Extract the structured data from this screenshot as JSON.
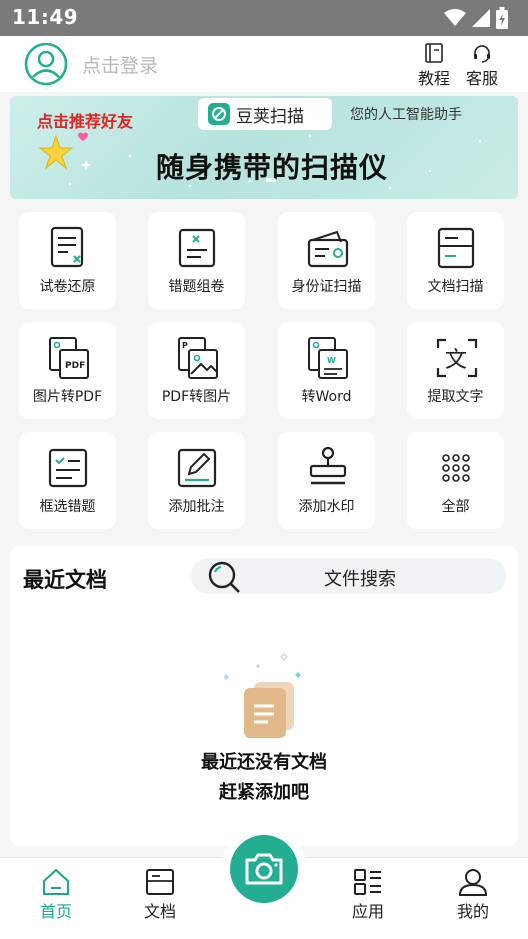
{
  "status_bar": {
    "time": "11:49"
  },
  "header": {
    "login_text": "点击登录",
    "tutorial": "教程",
    "service": "客服"
  },
  "banner": {
    "recommend": "点击推荐好友",
    "app_name": "豆荚扫描",
    "assistant": "您的人工智能助手",
    "slogan": "随身携带的扫描仪"
  },
  "tools": [
    {
      "label": "试卷还原",
      "icon": "paper-restore-icon"
    },
    {
      "label": "错题组卷",
      "icon": "wrong-question-icon"
    },
    {
      "label": "身份证扫描",
      "icon": "id-card-icon"
    },
    {
      "label": "文档扫描",
      "icon": "document-scan-icon"
    },
    {
      "label": "图片转PDF",
      "icon": "image-to-pdf-icon"
    },
    {
      "label": "PDF转图片",
      "icon": "pdf-to-image-icon"
    },
    {
      "label": "转Word",
      "icon": "to-word-icon"
    },
    {
      "label": "提取文字",
      "icon": "extract-text-icon"
    },
    {
      "label": "框选错题",
      "icon": "select-wrong-icon"
    },
    {
      "label": "添加批注",
      "icon": "annotate-icon"
    },
    {
      "label": "添加水印",
      "icon": "watermark-stamp-icon"
    },
    {
      "label": "全部",
      "icon": "all-apps-icon"
    }
  ],
  "recent": {
    "title": "最近文档",
    "search_label": "文件搜索",
    "empty_line1": "最近还没有文档",
    "empty_line2": "赶紧添加吧"
  },
  "tabs": [
    {
      "label": "首页",
      "icon": "home-icon",
      "active": true
    },
    {
      "label": "文档",
      "icon": "document-icon",
      "active": false
    },
    {
      "label": "应用",
      "icon": "apps-icon",
      "active": false
    },
    {
      "label": "我的",
      "icon": "profile-icon",
      "active": false
    }
  ],
  "colors": {
    "accent": "#23ad93",
    "recommend_red": "#e02424",
    "banner_bg": "#c8ece6"
  }
}
